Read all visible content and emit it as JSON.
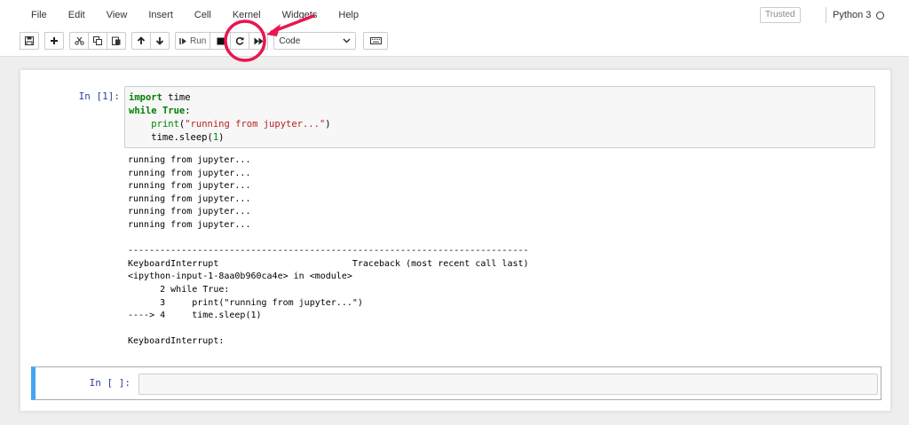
{
  "menu": [
    "File",
    "Edit",
    "View",
    "Insert",
    "Cell",
    "Kernel",
    "Widgets",
    "Help"
  ],
  "trusted_label": "Trusted",
  "kernel_name": "Python 3",
  "toolbar": {
    "run_label": "Run",
    "cell_type": "Code",
    "buttons": [
      "save-icon",
      "plus-icon",
      "cut-icon",
      "copy-icon",
      "paste-icon",
      "arrow-up-icon",
      "arrow-down-icon",
      "run-icon",
      "stop-icon",
      "restart-icon",
      "fast-forward-icon",
      "keyboard-icon"
    ]
  },
  "annotation": {
    "color": "#e8174f"
  },
  "cell1": {
    "prompt": "In [1]:",
    "code_lines": [
      [
        {
          "t": "import",
          "c": "kw"
        },
        {
          "t": " time",
          "c": ""
        }
      ],
      [
        {
          "t": "while",
          "c": "kw"
        },
        {
          "t": " ",
          "c": ""
        },
        {
          "t": "True",
          "c": "kw"
        },
        {
          "t": ":",
          "c": ""
        }
      ],
      [
        {
          "t": "    ",
          "c": ""
        },
        {
          "t": "print",
          "c": "bi"
        },
        {
          "t": "(",
          "c": ""
        },
        {
          "t": "\"running from jupyter...\"",
          "c": "st"
        },
        {
          "t": ")",
          "c": ""
        }
      ],
      [
        {
          "t": "    time.sleep(",
          "c": ""
        },
        {
          "t": "1",
          "c": "nm"
        },
        {
          "t": ")",
          "c": ""
        }
      ]
    ],
    "output_lines": [
      "running from jupyter...",
      "running from jupyter...",
      "running from jupyter...",
      "running from jupyter...",
      "running from jupyter...",
      "running from jupyter...",
      "",
      "---------------------------------------------------------------------------",
      "KeyboardInterrupt                         Traceback (most recent call last)",
      "<ipython-input-1-8aa0b960ca4e> in <module>",
      "      2 while True:",
      "      3     print(\"running from jupyter...\")",
      "----> 4     time.sleep(1)",
      "",
      "KeyboardInterrupt: "
    ]
  },
  "cell2": {
    "prompt": "In [ ]:"
  }
}
